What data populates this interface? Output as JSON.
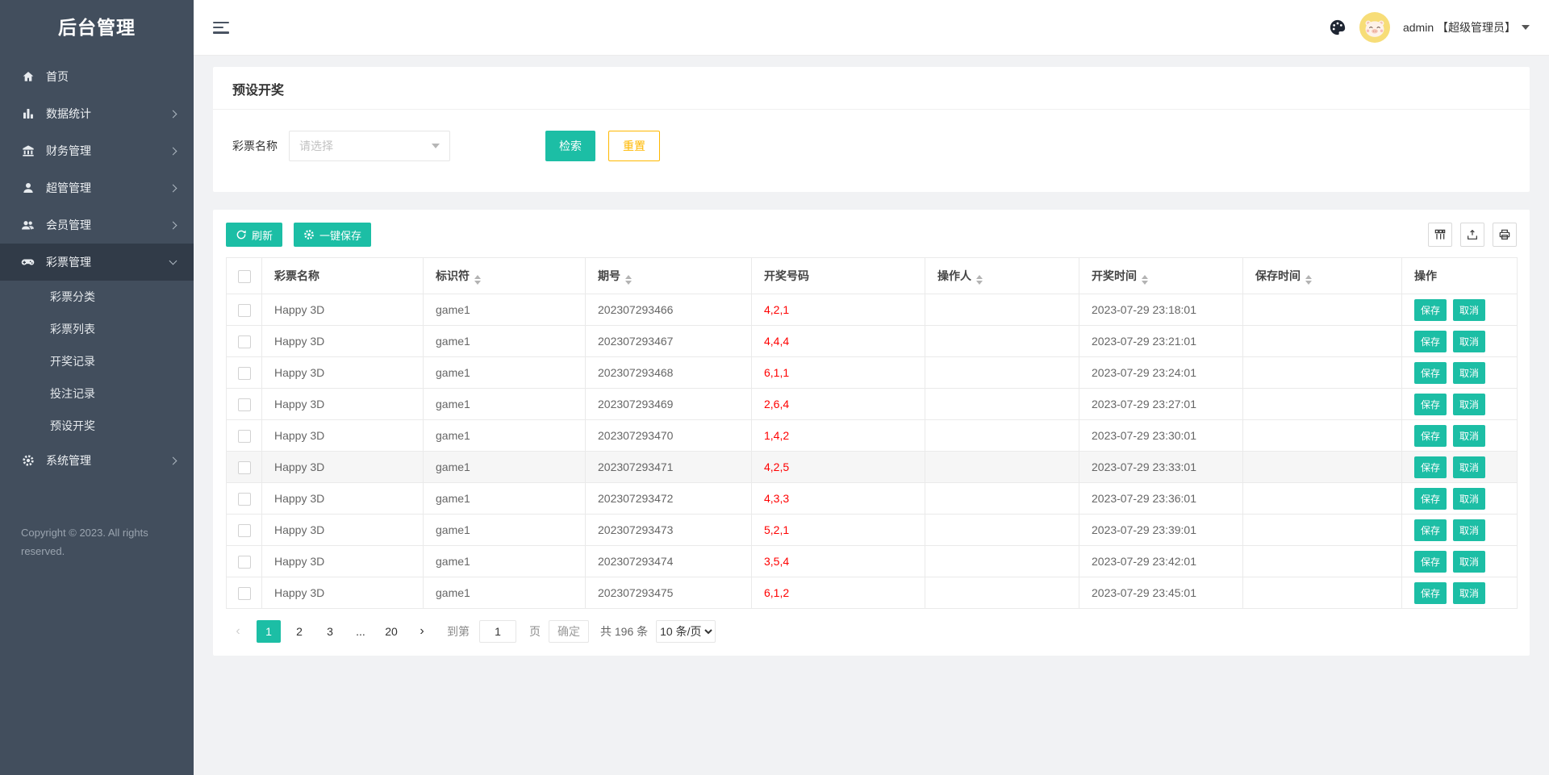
{
  "colors": {
    "teal": "#1cbea5",
    "gold": "#ffb800",
    "red": "#ff0000",
    "sidebar": "#424e5d",
    "sidebar_active": "#313b48"
  },
  "app": {
    "title": "后台管理",
    "copyright": "Copyright © 2023. All rights reserved."
  },
  "sidebar": {
    "items": [
      {
        "label": "首页",
        "icon": "home-icon",
        "chevron": "none"
      },
      {
        "label": "数据统计",
        "icon": "chart-icon",
        "chevron": "right"
      },
      {
        "label": "财务管理",
        "icon": "bank-icon",
        "chevron": "right"
      },
      {
        "label": "超管管理",
        "icon": "user-icon",
        "chevron": "right"
      },
      {
        "label": "会员管理",
        "icon": "users-icon",
        "chevron": "right"
      },
      {
        "label": "彩票管理",
        "icon": "gamepad-icon",
        "chevron": "down",
        "active": true,
        "children": [
          {
            "label": "彩票分类"
          },
          {
            "label": "彩票列表"
          },
          {
            "label": "开奖记录"
          },
          {
            "label": "投注记录"
          },
          {
            "label": "预设开奖"
          }
        ]
      },
      {
        "label": "系统管理",
        "icon": "gear-icon",
        "chevron": "right"
      }
    ]
  },
  "header": {
    "user_name": "admin 【超级管理员】"
  },
  "page": {
    "title": "预设开奖"
  },
  "filter": {
    "label": "彩票名称",
    "select_placeholder": "请选择",
    "search_label": "检索",
    "reset_label": "重置"
  },
  "toolbar": {
    "refresh_label": "刷新",
    "save_all_label": "一键保存"
  },
  "table": {
    "columns": [
      {
        "label": "彩票名称",
        "sortable": false
      },
      {
        "label": "标识符",
        "sortable": true
      },
      {
        "label": "期号",
        "sortable": true
      },
      {
        "label": "开奖号码",
        "sortable": false
      },
      {
        "label": "操作人",
        "sortable": true
      },
      {
        "label": "开奖时间",
        "sortable": true
      },
      {
        "label": "保存时间",
        "sortable": true
      },
      {
        "label": "操作",
        "sortable": false
      }
    ],
    "actions": {
      "save": "保存",
      "cancel": "取消"
    },
    "rows": [
      {
        "name": "Happy 3D",
        "code": "game1",
        "issue": "202307293466",
        "numbers": "4,2,1",
        "operator": "",
        "draw_time": "2023-07-29 23:18:01",
        "save_time": "",
        "highlighted": false
      },
      {
        "name": "Happy 3D",
        "code": "game1",
        "issue": "202307293467",
        "numbers": "4,4,4",
        "operator": "",
        "draw_time": "2023-07-29 23:21:01",
        "save_time": "",
        "highlighted": false
      },
      {
        "name": "Happy 3D",
        "code": "game1",
        "issue": "202307293468",
        "numbers": "6,1,1",
        "operator": "",
        "draw_time": "2023-07-29 23:24:01",
        "save_time": "",
        "highlighted": false
      },
      {
        "name": "Happy 3D",
        "code": "game1",
        "issue": "202307293469",
        "numbers": "2,6,4",
        "operator": "",
        "draw_time": "2023-07-29 23:27:01",
        "save_time": "",
        "highlighted": false
      },
      {
        "name": "Happy 3D",
        "code": "game1",
        "issue": "202307293470",
        "numbers": "1,4,2",
        "operator": "",
        "draw_time": "2023-07-29 23:30:01",
        "save_time": "",
        "highlighted": false
      },
      {
        "name": "Happy 3D",
        "code": "game1",
        "issue": "202307293471",
        "numbers": "4,2,5",
        "operator": "",
        "draw_time": "2023-07-29 23:33:01",
        "save_time": "",
        "highlighted": true
      },
      {
        "name": "Happy 3D",
        "code": "game1",
        "issue": "202307293472",
        "numbers": "4,3,3",
        "operator": "",
        "draw_time": "2023-07-29 23:36:01",
        "save_time": "",
        "highlighted": false
      },
      {
        "name": "Happy 3D",
        "code": "game1",
        "issue": "202307293473",
        "numbers": "5,2,1",
        "operator": "",
        "draw_time": "2023-07-29 23:39:01",
        "save_time": "",
        "highlighted": false
      },
      {
        "name": "Happy 3D",
        "code": "game1",
        "issue": "202307293474",
        "numbers": "3,5,4",
        "operator": "",
        "draw_time": "2023-07-29 23:42:01",
        "save_time": "",
        "highlighted": false
      },
      {
        "name": "Happy 3D",
        "code": "game1",
        "issue": "202307293475",
        "numbers": "6,1,2",
        "operator": "",
        "draw_time": "2023-07-29 23:45:01",
        "save_time": "",
        "highlighted": false
      }
    ]
  },
  "pagination": {
    "prev_label": "‹",
    "next_label": "›",
    "pages": [
      "1",
      "2",
      "3",
      "...",
      "20"
    ],
    "active_page": "1",
    "goto_prefix": "到第",
    "goto_value": "1",
    "goto_suffix": "页",
    "confirm_label": "确定",
    "total_label": "共 196 条",
    "per_page_label": "10 条/页"
  }
}
